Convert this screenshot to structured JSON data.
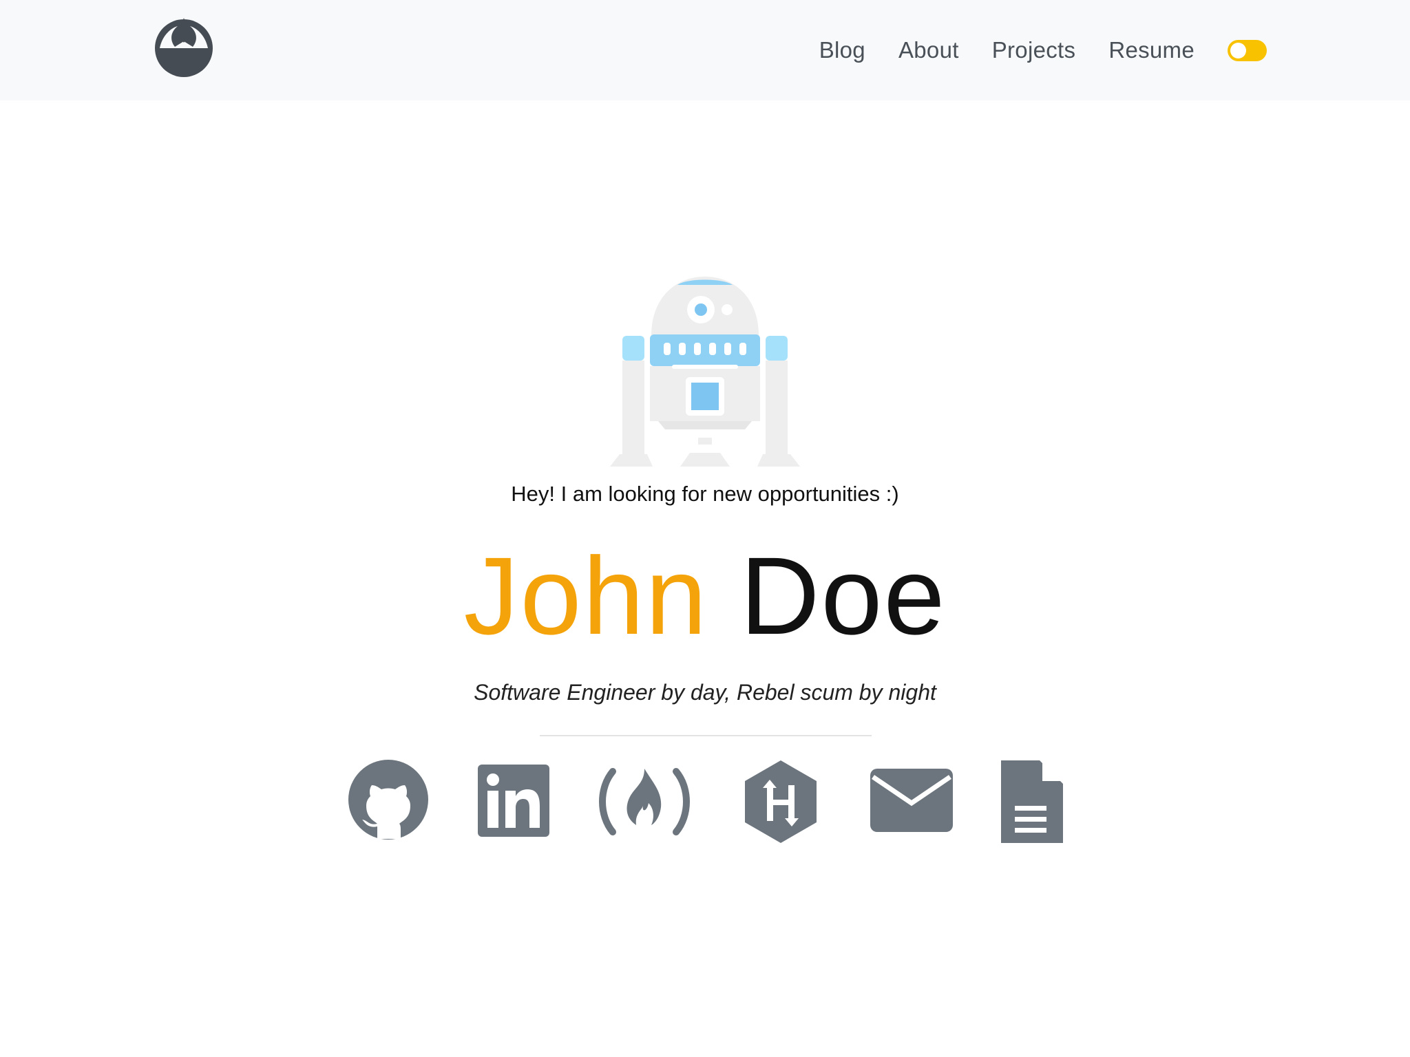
{
  "nav": {
    "brand_icon": "rebel-alliance-icon",
    "links": [
      "Blog",
      "About",
      "Projects",
      "Resume"
    ],
    "theme_toggle_color": "#f9c200"
  },
  "hero": {
    "illustration": "r2d2-droid-illustration",
    "tagline": "Hey! I am looking for new opportunities :)",
    "first_name": "John",
    "last_name": "Doe",
    "first_name_color": "#f5a30b",
    "subtitle": "Software Engineer by day, Rebel scum by night"
  },
  "socials": [
    {
      "icon": "github-icon"
    },
    {
      "icon": "linkedin-icon"
    },
    {
      "icon": "freecodecamp-icon"
    },
    {
      "icon": "hackerrank-icon"
    },
    {
      "icon": "email-icon"
    },
    {
      "icon": "resume-document-icon"
    }
  ],
  "colors": {
    "icon_gray": "#6c757d",
    "droid_blue": "#8fd0f5",
    "droid_body": "#eeeeee"
  }
}
